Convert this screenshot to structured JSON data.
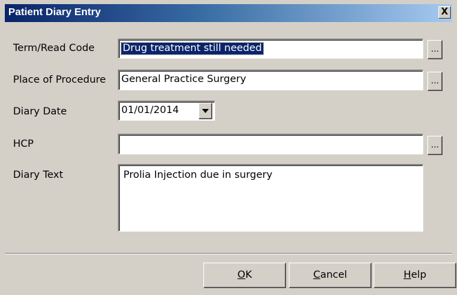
{
  "window": {
    "title": "Patient Diary Entry",
    "close_label": "X"
  },
  "fields": {
    "term": {
      "label": "Term/Read Code",
      "value": "Drug treatment still needed",
      "button": "..."
    },
    "place": {
      "label": "Place of Procedure",
      "value": "General Practice Surgery",
      "button": "..."
    },
    "date": {
      "label": "Diary Date",
      "value": "01/01/2014"
    },
    "hcp": {
      "label": "HCP",
      "value": "",
      "button": "..."
    },
    "diary_text": {
      "label": "Diary Text",
      "value": "Prolia Injection due in surgery"
    }
  },
  "buttons": {
    "ok": {
      "mnemonic": "O",
      "rest": "K"
    },
    "cancel": {
      "mnemonic": "C",
      "rest": "ancel"
    },
    "help": {
      "mnemonic": "H",
      "rest": "elp"
    }
  }
}
